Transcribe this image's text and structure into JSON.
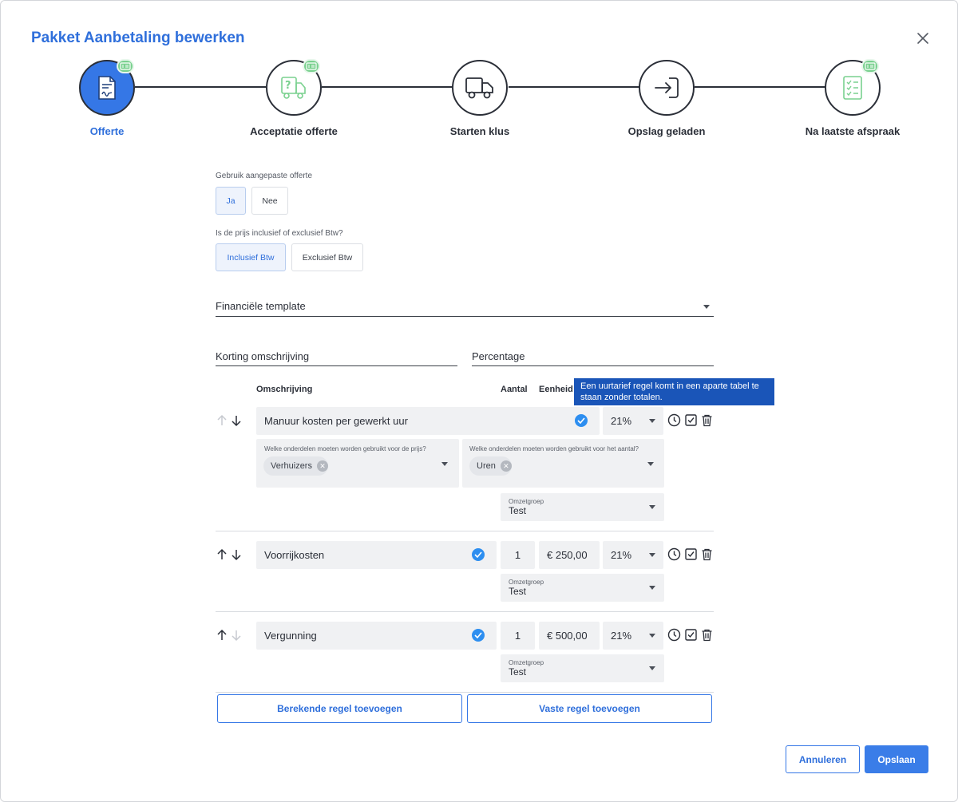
{
  "dialog": {
    "title": "Pakket Aanbetaling bewerken",
    "close_icon": "close-icon"
  },
  "steps": [
    {
      "label": "Offerte",
      "icon": "document-signature-icon",
      "active": true,
      "badge": true
    },
    {
      "label": "Acceptatie offerte",
      "icon": "truck-question-icon",
      "active": false,
      "badge": true
    },
    {
      "label": "Starten klus",
      "icon": "truck-icon",
      "active": false,
      "badge": false
    },
    {
      "label": "Opslag geladen",
      "icon": "arrow-into-icon",
      "active": false,
      "badge": false
    },
    {
      "label": "Na laatste afspraak",
      "icon": "checklist-icon",
      "active": false,
      "badge": true
    }
  ],
  "custom_quote": {
    "label": "Gebruik aangepaste offerte",
    "options": [
      "Ja",
      "Nee"
    ],
    "selected": "Ja"
  },
  "vat": {
    "label": "Is de prijs inclusief of exclusief Btw?",
    "options": [
      "Inclusief Btw",
      "Exclusief Btw"
    ],
    "selected": "Inclusief Btw"
  },
  "financial_template": {
    "label": "Financiële template"
  },
  "discount": {
    "description_label": "Korting omschrijving",
    "percentage_label": "Percentage"
  },
  "table": {
    "headers": {
      "description": "Omschrijving",
      "quantity": "Aantal",
      "unit": "Eenheid"
    },
    "tooltip": "Een uurtarief regel komt in een aparte tabel te staan zonder totalen."
  },
  "rows": [
    {
      "description": "Manuur kosten per gewerkt uur",
      "vat": "21%",
      "price_parts_label": "Welke onderdelen moeten worden gebruikt voor de prijs?",
      "price_parts": [
        "Verhuizers"
      ],
      "quantity_parts_label": "Welke onderdelen moeten worden gebruikt voor het aantal?",
      "quantity_parts": [
        "Uren"
      ],
      "revenue_group_label": "Omzetgroep",
      "revenue_group": "Test"
    },
    {
      "description": "Voorrijkosten",
      "quantity": "1",
      "price": "€ 250,00",
      "vat": "21%",
      "revenue_group_label": "Omzetgroep",
      "revenue_group": "Test"
    },
    {
      "description": "Vergunning",
      "quantity": "1",
      "price": "€ 500,00",
      "vat": "21%",
      "revenue_group_label": "Omzetgroep",
      "revenue_group": "Test"
    }
  ],
  "actions": {
    "add_calculated": "Berekende regel toevoegen",
    "add_fixed": "Vaste regel toevoegen",
    "cancel": "Annuleren",
    "save": "Opslaan"
  },
  "colors": {
    "accent": "#3577e6",
    "badge": "#7ad18f",
    "tooltip": "#1a55b8",
    "check": "#2d8ef0"
  }
}
